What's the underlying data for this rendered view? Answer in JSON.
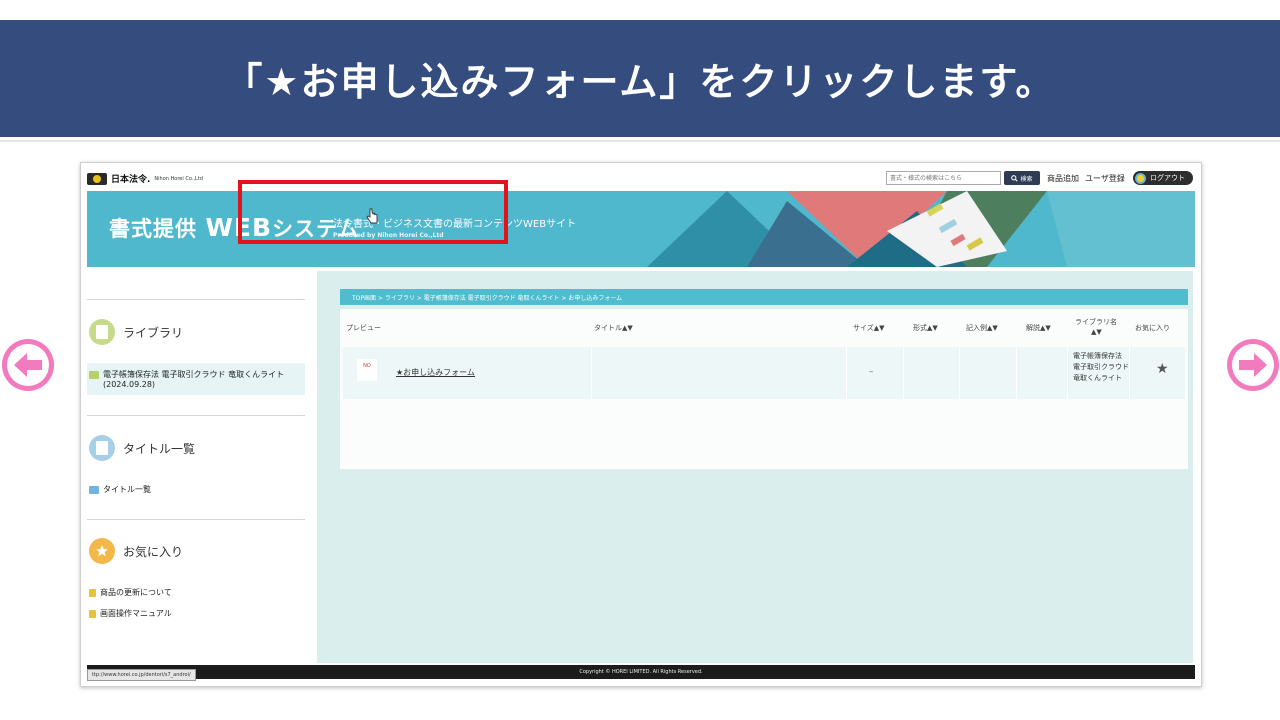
{
  "slide": {
    "title": "「★お申し込みフォーム」をクリックします。"
  },
  "nav": {
    "prev_label": "",
    "next_label": ""
  },
  "app": {
    "logo_jp": "日本法令.",
    "logo_en": "Nihon Horei Co.,Ltd",
    "search": {
      "placeholder": "書式・様式の検索はこちら",
      "button_label": "検索"
    },
    "toplinks": {
      "add_product": "商品追加",
      "user_register": "ユーザ登録",
      "logout": "ログアウト"
    },
    "banner": {
      "title_pre": "書式提供 ",
      "title_web": "WEB",
      "title_post": "システム",
      "subtitle": "法令書式・ビジネス文書の最新コンテンツWEBサイト",
      "produced_by": "Produced by Nihon Horei Co.,Ltd"
    },
    "sidebar": {
      "library_heading": "ライブラリ",
      "library_item_line1": "電子帳簿保存法 電子取引クラウド 竜取くんライト",
      "library_item_line2": "(2024.09.28)",
      "titles_heading": "タイトル一覧",
      "titles_item": "タイトル一覧",
      "favorites_heading": "お気に入り",
      "links": [
        "商品の更新について",
        "画面操作マニュアル"
      ]
    },
    "breadcrumb": "TOP画面 > ライブラリ > 電子帳簿保存法 電子取引クラウド 竜取くんライト > お申し込みフォーム",
    "table": {
      "headers": {
        "preview": "プレビュー",
        "title": "タイトル▲▼",
        "size": "サイズ▲▼",
        "format": "形式▲▼",
        "example": "記入例▲▼",
        "explanation": "解説▲▼",
        "library_name_1": "ライブラリ名",
        "library_name_2": "▲▼",
        "favorite": "お気に入り"
      },
      "row": {
        "preview_label": "NO",
        "title": "★お申し込みフォーム",
        "size": "–",
        "library_name": "電子帳簿保存法 電子取引クラウド 竜取くんライト"
      }
    },
    "footer": "Copyright © HOREI LIMITED. All Rights Reserved.",
    "status_url": "ttp://www.horei.co.jp/dentori/s7_androi/"
  },
  "colors": {
    "header_bg": "#344c7e",
    "banner_bg": "#50b8cc",
    "main_bg": "#daeeee",
    "highlight": "#e0151b",
    "nav_arrow": "#f27bbf"
  }
}
